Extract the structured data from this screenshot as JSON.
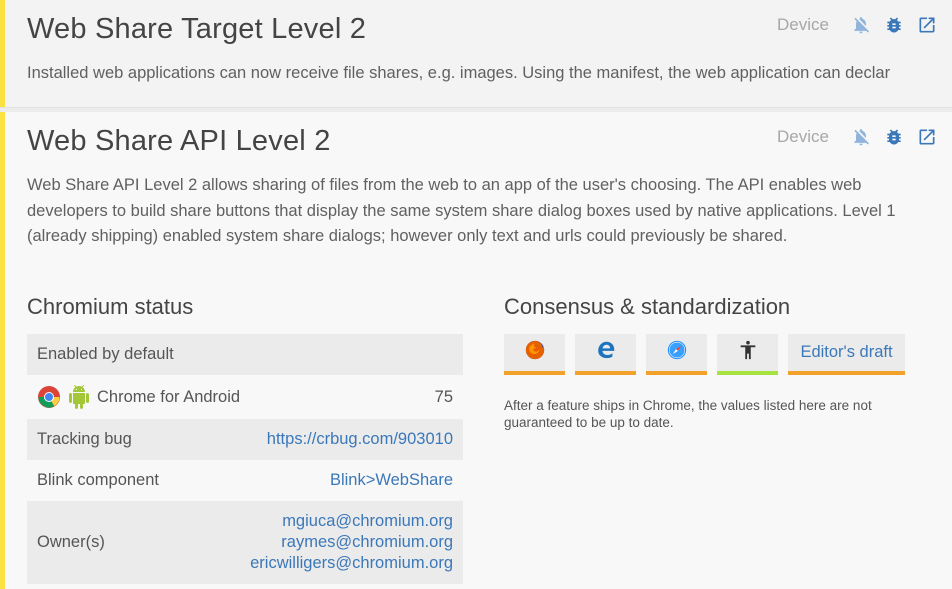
{
  "features": [
    {
      "title": "Web Share Target Level 2",
      "device_label": "Device",
      "summary": "Installed web applications can now receive file shares, e.g. images. Using the manifest, the web application can declar"
    },
    {
      "title": "Web Share API Level 2",
      "device_label": "Device",
      "summary": "Web Share API Level 2 allows sharing of files from the web to an app of the user's choosing.  The API enables web developers to build share buttons that display the same system share dialog boxes used by native applications. Level 1 (already shipping) enabled system share dialogs; however only text and urls could previously be shared.",
      "chromium_status": {
        "heading": "Chromium status",
        "enabled_label": "Enabled by default",
        "platform_label": "Chrome for Android",
        "platform_version": "75",
        "tracking_bug_label": "Tracking bug",
        "tracking_bug_url": "https://crbug.com/903010",
        "blink_component_label": "Blink component",
        "blink_component_value": "Blink>WebShare",
        "owners_label": "Owner(s)",
        "owners": [
          "mgiuca@chromium.org",
          "raymes@chromium.org",
          "ericwilligers@chromium.org"
        ]
      },
      "consensus": {
        "heading": "Consensus & standardization",
        "browsers": [
          {
            "icon": "firefox-icon",
            "status_color": "#f2a12b"
          },
          {
            "icon": "edge-icon",
            "status_color": "#f2a12b"
          },
          {
            "icon": "safari-icon",
            "status_color": "#f2a12b"
          },
          {
            "icon": "web-developers-icon",
            "status_color": "#a6e340"
          }
        ],
        "standard_label": "Editor's draft",
        "note": "After a feature ships in Chrome, the values listed here are not guaranteed to be up to date."
      }
    }
  ],
  "colors": {
    "accent": "#fbe241",
    "link": "#3b78b9",
    "icon_blue": "#3b78b9",
    "status_orange": "#f2a12b",
    "status_green": "#a6e340"
  }
}
